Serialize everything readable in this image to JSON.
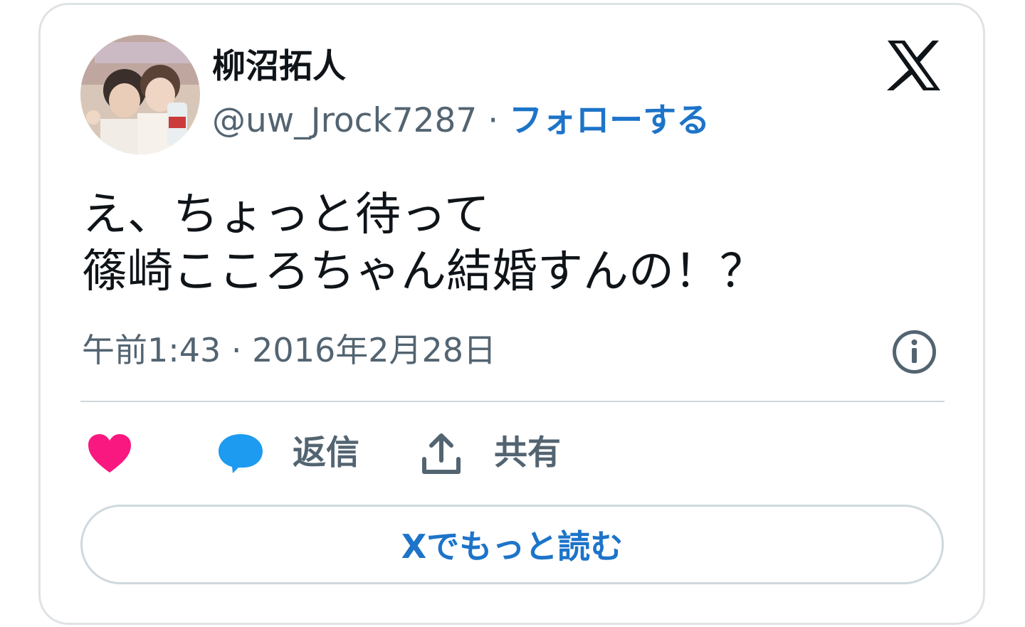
{
  "author": {
    "display_name": "柳沼拓人",
    "handle": "@uw_Jrock7287",
    "separator": " · ",
    "follow_label": "フォローする",
    "avatar_icon": "profile-photo"
  },
  "tweet": {
    "lines": [
      "え、ちょっと待って",
      "篠崎こころちゃん結婚すんの！？"
    ],
    "timestamp": "午前1:43 · 2016年2月28日"
  },
  "actions": {
    "like_icon": "heart-icon",
    "reply_label": "返信",
    "share_label": "共有"
  },
  "footer": {
    "read_more_label": "Xでもっと読む"
  },
  "colors": {
    "accent": "#1d74c9",
    "like": "#f91880",
    "reply": "#1d9bf0",
    "text": "#0f1419",
    "muted": "#536471"
  }
}
